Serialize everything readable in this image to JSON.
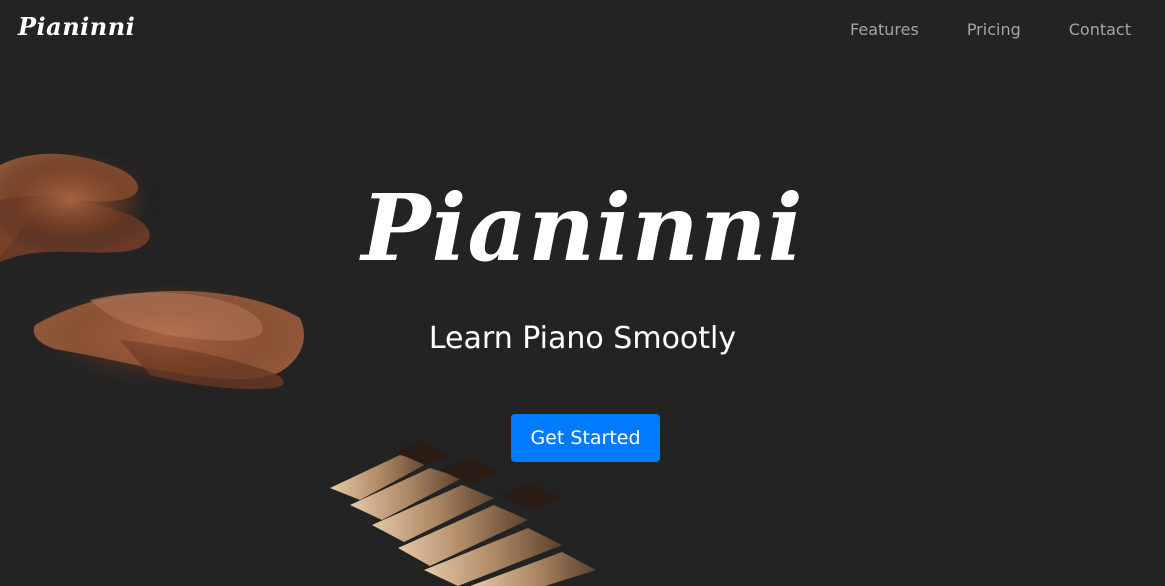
{
  "navbar": {
    "brand": "Pianinni",
    "links": [
      "Features",
      "Pricing",
      "Contact"
    ]
  },
  "hero": {
    "title": "Pianinni",
    "subtitle": "Learn Piano Smootly",
    "cta_label": "Get Started",
    "background_image": "hands-playing-piano-photo"
  },
  "colors": {
    "background": "#232323",
    "nav_link": "#a5a5a5",
    "text": "#ffffff",
    "cta_button": "#007bff"
  }
}
